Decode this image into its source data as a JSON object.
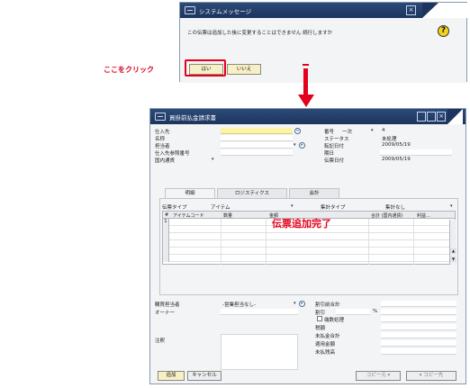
{
  "annotations": {
    "click_here": "ここをクリック",
    "slip_added": "伝票追加完了"
  },
  "dialog": {
    "title": "システムメッセージ",
    "message": "この伝票は追加した後に変更することはできません 続行しますか",
    "yes_label": "はい",
    "no_label": "いいえ",
    "question_icon": "?"
  },
  "window": {
    "title": "買掛前払金請求書",
    "close_glyph": "×",
    "left_fields": [
      {
        "label": "仕入先"
      },
      {
        "label": "名称"
      },
      {
        "label": "担当者"
      },
      {
        "label": "仕入先参照番号"
      }
    ],
    "currency": "国内通貨",
    "right_fields": [
      {
        "label": "番号",
        "value": "4",
        "series": "一次"
      },
      {
        "label": "ステータス",
        "value": "未処理"
      },
      {
        "label": "転記日付",
        "value": "2009/05/19"
      },
      {
        "label": "期日",
        "value": ""
      },
      {
        "label": "伝票日付",
        "value": "2009/05/19"
      }
    ],
    "tabs": [
      "明細",
      "ロジスティクス",
      "会計"
    ],
    "doc_type_label": "伝票タイプ",
    "doc_type_value": "アイテム",
    "summary_type_label": "集計タイプ",
    "summary_type_value": "集計なし",
    "grid_headers": [
      "#",
      "アイテムコード",
      "数量",
      "金額",
      "合計 (国内通貨)",
      "利益..."
    ],
    "grid_first_row": "1",
    "sales_rep_label": "購買担当者",
    "sales_rep_value": "-営業担当なし-",
    "owner_label": "オーナー",
    "remarks_label": "注釈",
    "totals": [
      {
        "label": "割引前合計"
      },
      {
        "label": "割引",
        "suffix": "%"
      },
      {
        "label": "端数処理",
        "checkbox": true
      },
      {
        "label": "税額"
      },
      {
        "label": "未払金合計"
      },
      {
        "label": "適用金額"
      },
      {
        "label": "未払残高"
      }
    ],
    "add_button": "追加",
    "cancel_button": "キャンセル",
    "copy_from_button": "コピー元",
    "copy_to_button": "コピー先"
  }
}
